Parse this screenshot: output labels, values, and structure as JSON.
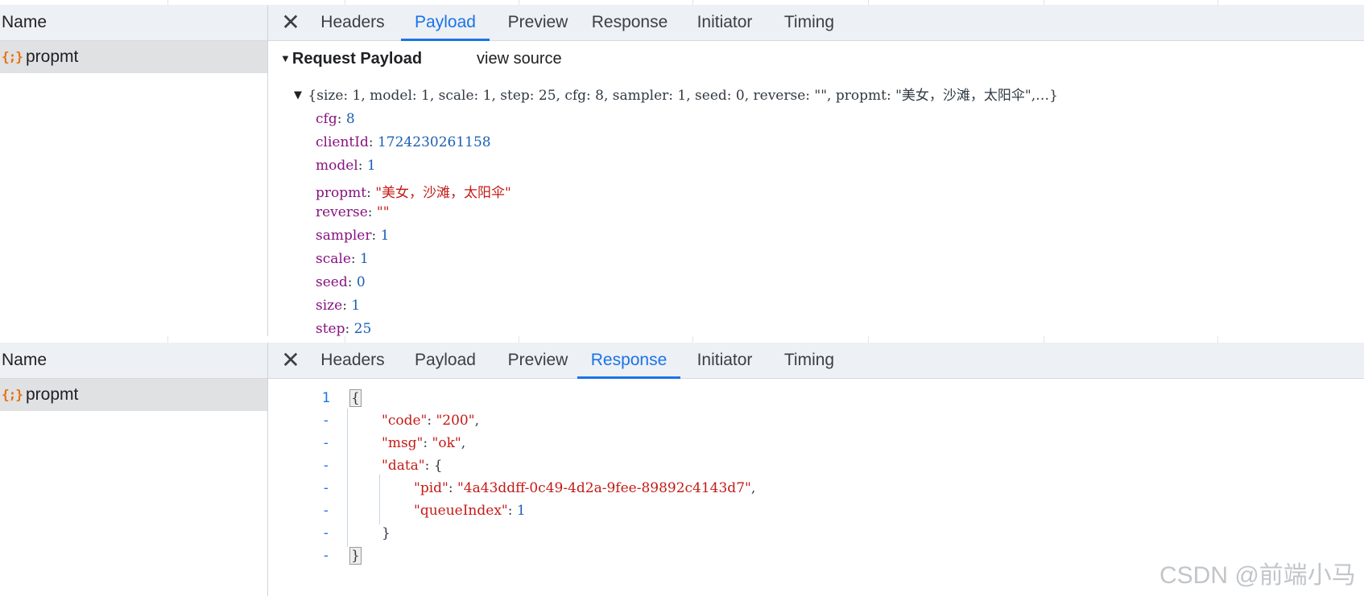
{
  "top_panel": {
    "name_header": "Name",
    "request_icon": "{;}",
    "request_name": "propmt",
    "tabs": [
      "Headers",
      "Payload",
      "Preview",
      "Response",
      "Initiator",
      "Timing"
    ],
    "active_tab": "Payload",
    "section_title": "Request Payload",
    "view_source": "view source",
    "summary": "{size: 1, model: 1, scale: 1, step: 25, cfg: 8, sampler: 1, seed: 0, reverse: \"\", propmt: \"美女，沙滩，太阳伞\",…}",
    "properties": [
      {
        "key": "cfg",
        "value": "8",
        "type": "number"
      },
      {
        "key": "clientId",
        "value": "1724230261158",
        "type": "number"
      },
      {
        "key": "model",
        "value": "1",
        "type": "number"
      },
      {
        "key": "propmt",
        "value": "\"美女，沙滩，太阳伞\"",
        "type": "string"
      },
      {
        "key": "reverse",
        "value": "\"\"",
        "type": "string"
      },
      {
        "key": "sampler",
        "value": "1",
        "type": "number"
      },
      {
        "key": "scale",
        "value": "1",
        "type": "number"
      },
      {
        "key": "seed",
        "value": "0",
        "type": "number"
      },
      {
        "key": "size",
        "value": "1",
        "type": "number"
      },
      {
        "key": "step",
        "value": "25",
        "type": "number"
      }
    ]
  },
  "bottom_panel": {
    "name_header": "Name",
    "request_icon": "{;}",
    "request_name": "propmt",
    "tabs": [
      "Headers",
      "Payload",
      "Preview",
      "Response",
      "Initiator",
      "Timing"
    ],
    "active_tab": "Response",
    "line_numbers": [
      "1",
      "-",
      "-",
      "-",
      "-",
      "-",
      "-",
      "-"
    ],
    "lines": {
      "open": "{",
      "code_key": "\"code\"",
      "code_val": "\"200\"",
      "msg_key": "\"msg\"",
      "msg_val": "\"ok\"",
      "data_key": "\"data\"",
      "data_open": "{",
      "pid_key": "\"pid\"",
      "pid_val": "\"4a43ddff-0c49-4d2a-9fee-89892c4143d7\"",
      "qi_key": "\"queueIndex\"",
      "qi_val": "1",
      "data_close": "}",
      "close": "}"
    }
  },
  "watermark": "CSDN @前端小马",
  "colors": {
    "accent": "#1a73e8",
    "string": "#c41a16",
    "key": "#881280",
    "number": "#1a5fb4",
    "icon": "#e8710a"
  }
}
